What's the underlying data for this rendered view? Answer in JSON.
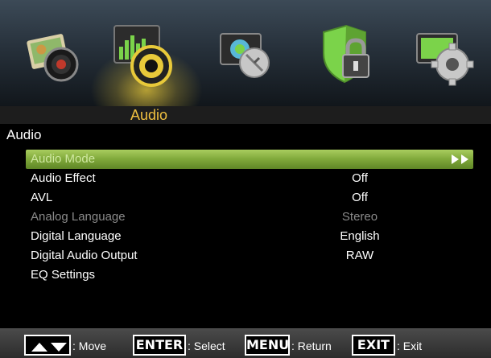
{
  "categories": [
    {
      "name": "picture",
      "icon": "picture-camera-icon"
    },
    {
      "name": "audio",
      "icon": "audio-speaker-icon",
      "active": true
    },
    {
      "name": "channel",
      "icon": "channel-satellite-icon"
    },
    {
      "name": "lock",
      "icon": "lock-shield-icon"
    },
    {
      "name": "setup",
      "icon": "setup-gear-icon"
    }
  ],
  "active_tab": "Audio",
  "section_title": "Audio",
  "menu": {
    "items": [
      {
        "label": "Audio Mode",
        "value": "",
        "selected": true
      },
      {
        "label": "Audio Effect",
        "value": "Off"
      },
      {
        "label": "AVL",
        "value": "Off"
      },
      {
        "label": "Analog Language",
        "value": "Stereo",
        "disabled": true
      },
      {
        "label": "Digital Language",
        "value": "English"
      },
      {
        "label": "Digital Audio Output",
        "value": "RAW"
      },
      {
        "label": "EQ Settings",
        "value": ""
      }
    ]
  },
  "footer": {
    "move_key": "▲▼",
    "move_label": ": Move",
    "enter_key": "ENTER",
    "enter_label": ": Select",
    "menu_key": "MENU",
    "menu_label": ": Return",
    "exit_key": "EXIT",
    "exit_label": ": Exit"
  },
  "colors": {
    "accent": "#f0c040",
    "selected_bar": "#7fa83a"
  }
}
